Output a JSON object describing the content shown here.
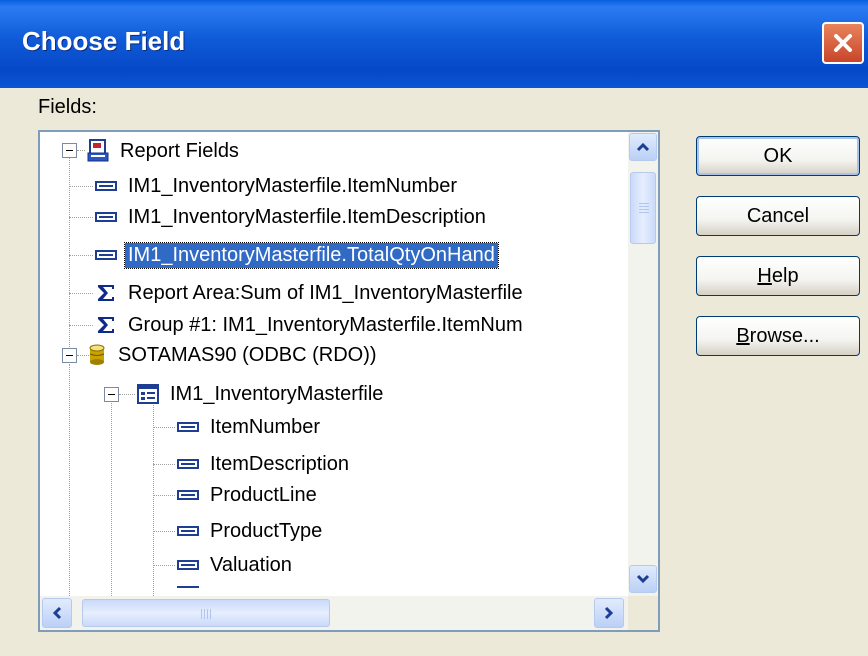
{
  "window": {
    "title": "Choose Field"
  },
  "labels": {
    "fields": "Fields:"
  },
  "tree": {
    "items": [
      {
        "label": "Report Fields",
        "icon": "report-icon"
      },
      {
        "label": "IM1_InventoryMasterfile.ItemNumber",
        "icon": "field-icon"
      },
      {
        "label": "IM1_InventoryMasterfile.ItemDescription",
        "icon": "field-icon"
      },
      {
        "label": "IM1_InventoryMasterfile.TotalQtyOnHand",
        "icon": "field-icon",
        "selected": true
      },
      {
        "label": "Report Area:Sum of IM1_InventoryMasterfile",
        "icon": "sigma-icon"
      },
      {
        "label": "Group #1: IM1_InventoryMasterfile.ItemNum",
        "icon": "sigma-icon"
      },
      {
        "label": "SOTAMAS90 (ODBC (RDO))",
        "icon": "database-icon"
      },
      {
        "label": "IM1_InventoryMasterfile",
        "icon": "table-icon"
      },
      {
        "label": "ItemNumber",
        "icon": "field-icon"
      },
      {
        "label": "ItemDescription",
        "icon": "field-icon"
      },
      {
        "label": "ProductLine",
        "icon": "field-icon"
      },
      {
        "label": "ProductType",
        "icon": "field-icon"
      },
      {
        "label": "Valuation",
        "icon": "field-icon"
      }
    ]
  },
  "buttons": {
    "ok": "OK",
    "cancel": "Cancel",
    "help_mnemonic": "H",
    "help_rest": "elp",
    "browse_mnemonic": "B",
    "browse_rest": "rowse..."
  },
  "colors": {
    "titlebar": "#0A55D5",
    "selection": "#316AC5",
    "dialog_bg": "#ECE9D8"
  }
}
